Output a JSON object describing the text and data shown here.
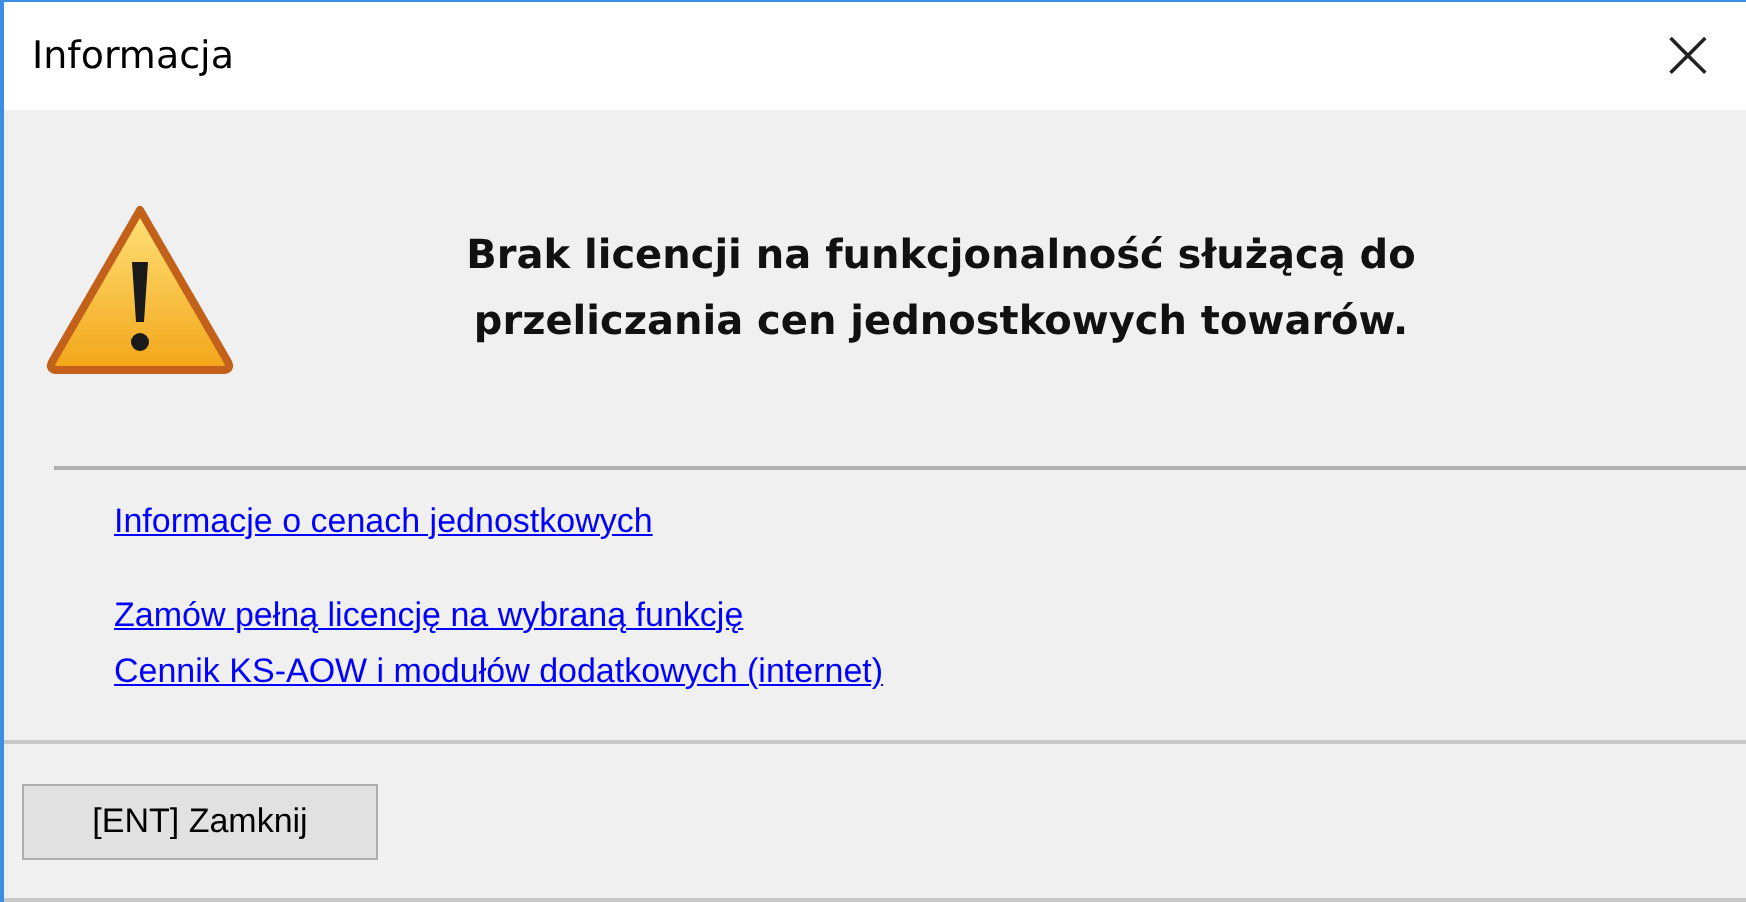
{
  "window": {
    "title": "Informacja",
    "close": "×"
  },
  "message": [
    "Brak licencji na funkcjonalność służącą do",
    "przeliczania cen jednostkowych towarów."
  ],
  "link_groups": [
    [
      "Informacje o cenach jednostkowych"
    ],
    [
      "Zamów pełną licencję na wybraną funkcję",
      "Cennik KS-AOW i modułów dodatkowych (internet)"
    ]
  ],
  "buttons": [
    "[ENT] Zamknij"
  ]
}
